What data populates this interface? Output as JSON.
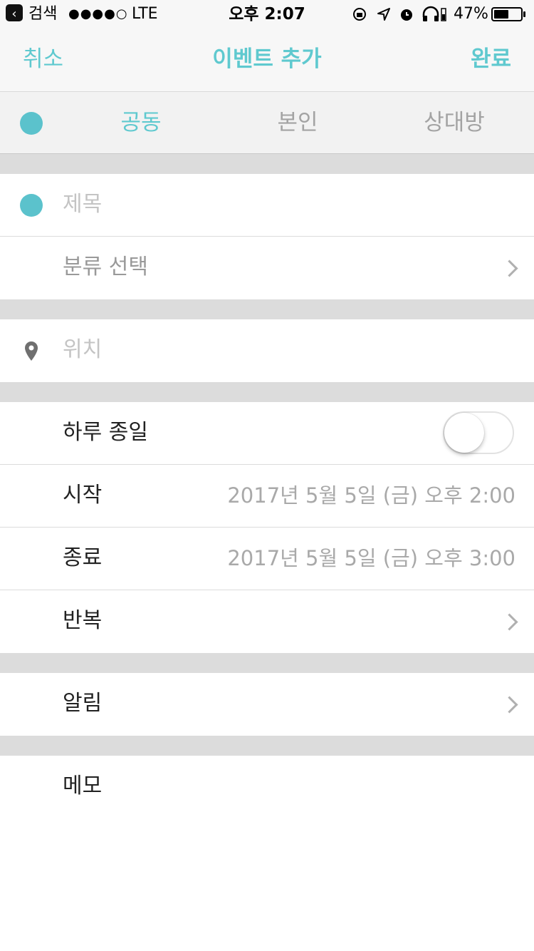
{
  "status_bar": {
    "back_app": "검색",
    "signal": "●●●●○",
    "network": "LTE",
    "time": "오후 2:07",
    "battery": "47%"
  },
  "nav": {
    "cancel": "취소",
    "title": "이벤트 추가",
    "done": "완료"
  },
  "owner_tabs": [
    {
      "label": "공동",
      "active": true
    },
    {
      "label": "본인",
      "active": false
    },
    {
      "label": "상대방",
      "active": false
    }
  ],
  "form": {
    "title_placeholder": "제목",
    "category_placeholder": "분류 선택",
    "location_placeholder": "위치",
    "all_day_label": "하루 종일",
    "all_day_on": false,
    "start_label": "시작",
    "start_value": "2017년 5월 5일 (금) 오후 2:00",
    "end_label": "종료",
    "end_value": "2017년 5월 5일 (금) 오후 3:00",
    "repeat_label": "반복",
    "alarm_label": "알림",
    "memo_label": "메모"
  },
  "colors": {
    "accent": "#5fc9cf",
    "dot": "#5bc2cc"
  }
}
